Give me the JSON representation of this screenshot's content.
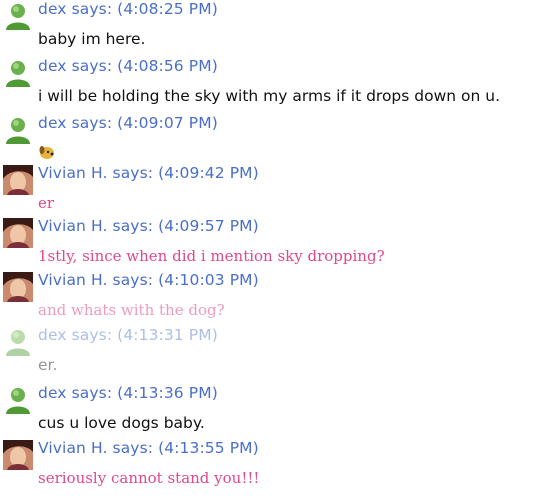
{
  "colors": {
    "header_text": "#4a6fc9",
    "dex_text": "#111111",
    "vivian_text": "#e0488b",
    "dex_avatar": "#6ab04c",
    "vivian_avatar": "#8a4a3a"
  },
  "messages": [
    {
      "sender": "dex",
      "header": "dex says: (4:08:25 PM)",
      "text": "baby im here."
    },
    {
      "sender": "dex",
      "header": "dex says: (4:08:56 PM)",
      "text": "i will be holding the sky with my arms if it drops down on u."
    },
    {
      "sender": "dex",
      "header": "dex says: (4:09:07 PM)",
      "text": "",
      "icon": "dog-emoticon-icon"
    },
    {
      "sender": "Vivian H.",
      "header": "Vivian H. says: (4:09:42 PM)",
      "text": "er"
    },
    {
      "sender": "Vivian H.",
      "header": "Vivian H. says: (4:09:57 PM)",
      "text": "1stly, since when did i mention sky dropping?"
    },
    {
      "sender": "Vivian H.",
      "header": "Vivian H. says: (4:10:03 PM)",
      "text": "and whats with the dog?"
    },
    {
      "sender": "dex",
      "header": "dex says: (4:13:31 PM)",
      "text": "er."
    },
    {
      "sender": "dex",
      "header": "dex says: (4:13:36 PM)",
      "text": "cus u love dogs baby."
    },
    {
      "sender": "Vivian H.",
      "header": "Vivian H. says: (4:13:55 PM)",
      "text": "seriously cannot stand you!!!"
    }
  ]
}
